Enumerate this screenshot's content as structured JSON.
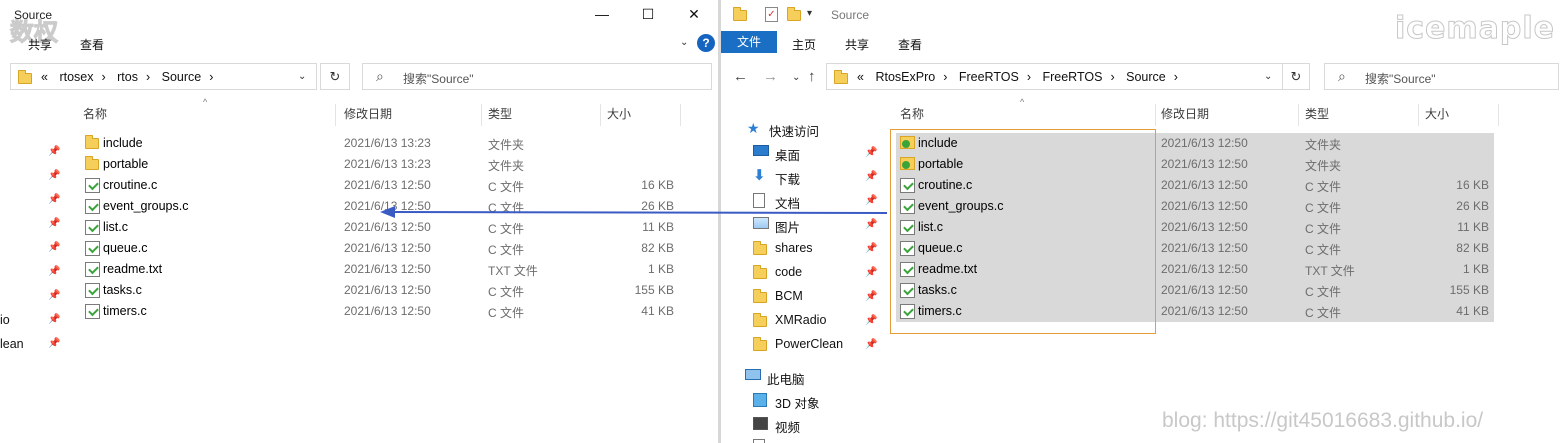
{
  "left": {
    "title": "Source",
    "tabs": [
      "共享",
      "查看"
    ],
    "path": [
      "«",
      "rtosex",
      "rtos",
      "Source"
    ],
    "search_placeholder": "搜索\"Source\"",
    "columns": {
      "name": "名称",
      "date": "修改日期",
      "type": "类型",
      "size": "大小"
    },
    "files": [
      {
        "name": "include",
        "date": "2021/6/13 13:23",
        "type": "文件夹",
        "size": "",
        "kind": "folder"
      },
      {
        "name": "portable",
        "date": "2021/6/13 13:23",
        "type": "文件夹",
        "size": "",
        "kind": "folder"
      },
      {
        "name": "croutine.c",
        "date": "2021/6/13 12:50",
        "type": "C 文件",
        "size": "16 KB",
        "kind": "c"
      },
      {
        "name": "event_groups.c",
        "date": "2021/6/13 12:50",
        "type": "C 文件",
        "size": "26 KB",
        "kind": "c"
      },
      {
        "name": "list.c",
        "date": "2021/6/13 12:50",
        "type": "C 文件",
        "size": "11 KB",
        "kind": "c"
      },
      {
        "name": "queue.c",
        "date": "2021/6/13 12:50",
        "type": "C 文件",
        "size": "82 KB",
        "kind": "c"
      },
      {
        "name": "readme.txt",
        "date": "2021/6/13 12:50",
        "type": "TXT 文件",
        "size": "1 KB",
        "kind": "c"
      },
      {
        "name": "tasks.c",
        "date": "2021/6/13 12:50",
        "type": "C 文件",
        "size": "155 KB",
        "kind": "c"
      },
      {
        "name": "timers.c",
        "date": "2021/6/13 12:50",
        "type": "C 文件",
        "size": "41 KB",
        "kind": "c"
      }
    ],
    "nav_partial": [
      "io",
      "lean"
    ],
    "watermark": "数权"
  },
  "right": {
    "title": "Source",
    "tabs": [
      "文件",
      "主页",
      "共享",
      "查看"
    ],
    "path": [
      "«",
      "RtosExPro",
      "FreeRTOS",
      "FreeRTOS",
      "Source"
    ],
    "search_placeholder": "搜索\"Source\"",
    "columns": {
      "name": "名称",
      "date": "修改日期",
      "type": "类型",
      "size": "大小"
    },
    "quick_access": "快速访问",
    "nav": [
      {
        "label": "桌面",
        "icon": "desktop-icon"
      },
      {
        "label": "下载",
        "icon": "download-icon"
      },
      {
        "label": "文档",
        "icon": "document-icon"
      },
      {
        "label": "图片",
        "icon": "pictures-icon"
      },
      {
        "label": "shares",
        "icon": "folder-icon"
      },
      {
        "label": "code",
        "icon": "folder-icon"
      },
      {
        "label": "BCM",
        "icon": "folder-icon"
      },
      {
        "label": "XMRadio",
        "icon": "folder-icon"
      },
      {
        "label": "PowerClean",
        "icon": "folder-icon"
      }
    ],
    "this_pc": "此电脑",
    "pc_items": [
      "3D 对象",
      "视频"
    ],
    "files": [
      {
        "name": "include",
        "date": "2021/6/13 12:50",
        "type": "文件夹",
        "size": "",
        "kind": "folder"
      },
      {
        "name": "portable",
        "date": "2021/6/13 12:50",
        "type": "文件夹",
        "size": "",
        "kind": "folder"
      },
      {
        "name": "croutine.c",
        "date": "2021/6/13 12:50",
        "type": "C 文件",
        "size": "16 KB",
        "kind": "c"
      },
      {
        "name": "event_groups.c",
        "date": "2021/6/13 12:50",
        "type": "C 文件",
        "size": "26 KB",
        "kind": "c"
      },
      {
        "name": "list.c",
        "date": "2021/6/13 12:50",
        "type": "C 文件",
        "size": "11 KB",
        "kind": "c"
      },
      {
        "name": "queue.c",
        "date": "2021/6/13 12:50",
        "type": "C 文件",
        "size": "82 KB",
        "kind": "c"
      },
      {
        "name": "readme.txt",
        "date": "2021/6/13 12:50",
        "type": "TXT 文件",
        "size": "1 KB",
        "kind": "c"
      },
      {
        "name": "tasks.c",
        "date": "2021/6/13 12:50",
        "type": "C 文件",
        "size": "155 KB",
        "kind": "c"
      },
      {
        "name": "timers.c",
        "date": "2021/6/13 12:50",
        "type": "C 文件",
        "size": "41 KB",
        "kind": "c"
      }
    ],
    "watermark": "icemaple",
    "blog": "blog: https://git45016683.github.io/"
  },
  "colors": {
    "accent": "#1a6fc4",
    "selection": "#d9d9d9",
    "arrow": "#3b5bc4",
    "box": "#e59c3a"
  }
}
